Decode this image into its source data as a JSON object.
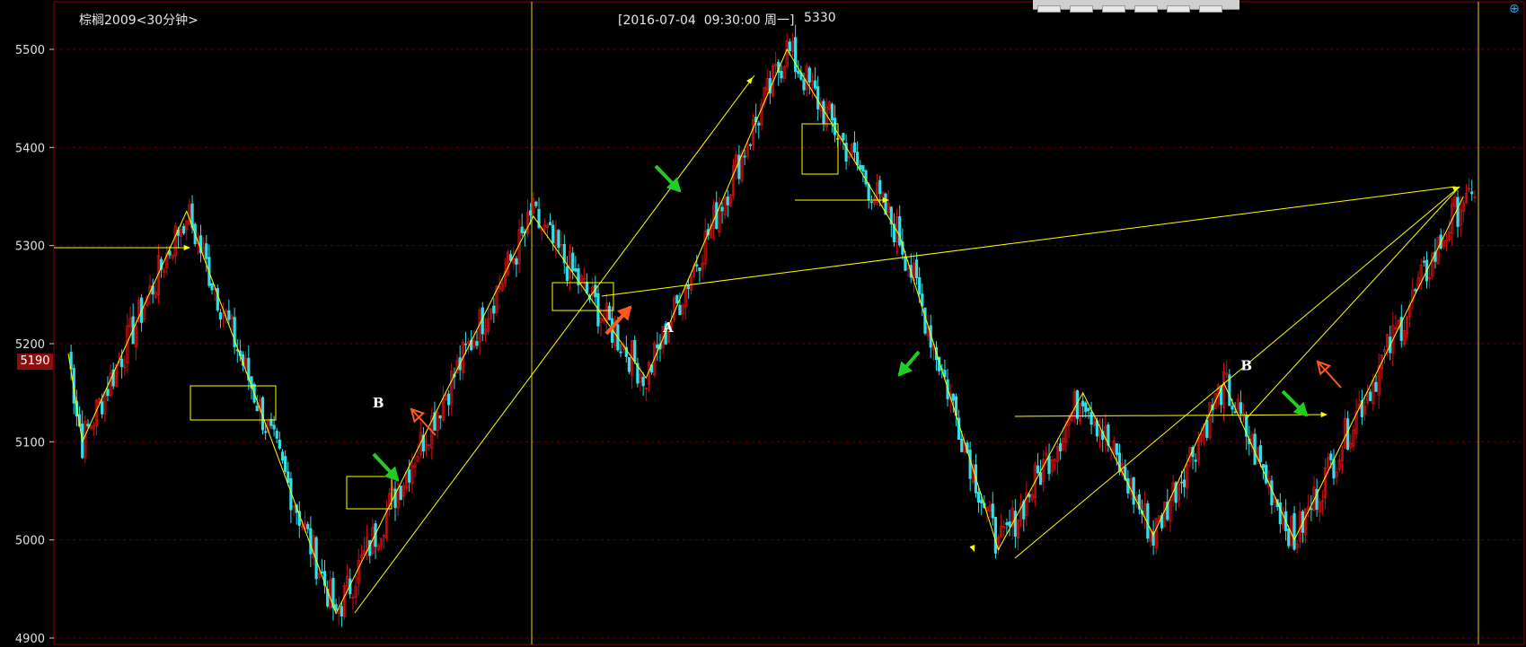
{
  "header": {
    "instrument": "棕榈2009<30分钟>",
    "cursor_time": "[2016-07-04  09:30:00 周一]",
    "cursor_value": "5330"
  },
  "price_tag": "5190",
  "colors": {
    "background": "#000000",
    "up_candle": "#d01010",
    "down_candle": "#30e0e8",
    "drawing": "#ffff00",
    "green_arrow": "#22cc22",
    "orange_arrow": "#ff5a1a",
    "frame": "#8b0000",
    "grid": "#6b0000"
  },
  "icons": {
    "zoom": "zoom-in-icon"
  },
  "chart_data": {
    "type": "candlestick",
    "ylim": [
      4900,
      5550
    ],
    "yticks": [
      4900,
      5000,
      5100,
      5200,
      5300,
      5400,
      5500
    ],
    "grid": true,
    "legend": "none",
    "zigzag_pivots": [
      [
        0,
        5190
      ],
      [
        5,
        5100
      ],
      [
        42,
        5335
      ],
      [
        95,
        4925
      ],
      [
        165,
        5330
      ],
      [
        205,
        5165
      ],
      [
        255,
        5500
      ],
      [
        295,
        5310
      ],
      [
        330,
        4990
      ],
      [
        360,
        5150
      ],
      [
        385,
        5005
      ],
      [
        410,
        5160
      ],
      [
        435,
        5000
      ],
      [
        495,
        5350
      ]
    ],
    "annotations": [
      {
        "label": "B",
        "near_bar": 108,
        "price": 5135
      },
      {
        "label": "A",
        "near_bar": 211,
        "price": 5212
      },
      {
        "label": "B",
        "near_bar": 416,
        "price": 5173
      }
    ]
  }
}
